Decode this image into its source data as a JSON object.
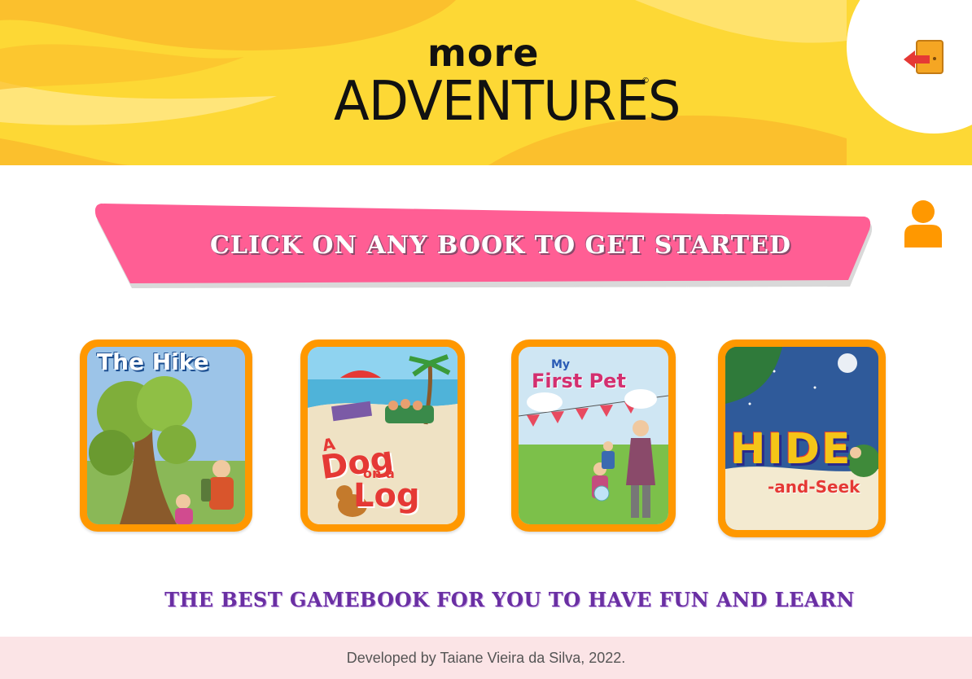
{
  "header": {
    "logo_top": "more",
    "logo_main": "ADVENTURES",
    "logo_mark": "©"
  },
  "banner": {
    "text": "Click on any book to get started"
  },
  "books": [
    {
      "title": "The Hike"
    },
    {
      "title_line1": "A",
      "title_line2": "Dog",
      "title_line3": "on a",
      "title_line4": "Log"
    },
    {
      "title_small": "My",
      "title": "First Pet"
    },
    {
      "title": "HIDE",
      "subtitle": "-and-Seek"
    }
  ],
  "tagline": "The best gamebook for you to have fun and learn",
  "footer": {
    "text": "Developed by Taiane Vieira da Silva, 2022."
  },
  "colors": {
    "header": "#fdd835",
    "banner": "#ff5e94",
    "book_border": "#ff9800",
    "tagline": "#6a2fa3",
    "footer": "#fbe4e6",
    "user": "#ff9800"
  },
  "icons": {
    "exit": "exit-door-icon",
    "user": "user-icon"
  }
}
